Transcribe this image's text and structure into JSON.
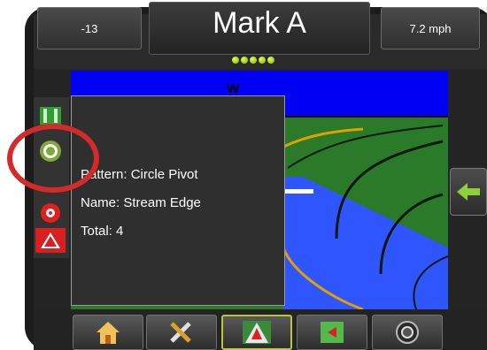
{
  "header": {
    "left_value": "-13",
    "title": "Mark A",
    "right_value": "7.2 mph",
    "signal_dots": 5
  },
  "map": {
    "compass_label": "W"
  },
  "popup": {
    "pattern": "Pattern: Circle Pivot",
    "name": "Name: Stream Edge",
    "total": "Total: 4"
  },
  "left_toolbar": {
    "items": [
      {
        "icon": "field-boundary-icon"
      },
      {
        "icon": "circle-pivot-icon"
      },
      {
        "icon": "marker-icon"
      },
      {
        "icon": "guidance-warning-icon"
      }
    ]
  },
  "bottom_toolbar": {
    "items": [
      {
        "icon": "home-icon"
      },
      {
        "icon": "tools-icon"
      },
      {
        "icon": "vehicle-view-icon",
        "active": true
      },
      {
        "icon": "field-view-icon"
      },
      {
        "icon": "speaker-icon"
      }
    ]
  },
  "colors": {
    "sky": "#0000f5",
    "field": "#2a7a2a",
    "water": "#2f55ff",
    "highlight_ring": "#d42a2a",
    "active_button": "#b8c83a"
  }
}
